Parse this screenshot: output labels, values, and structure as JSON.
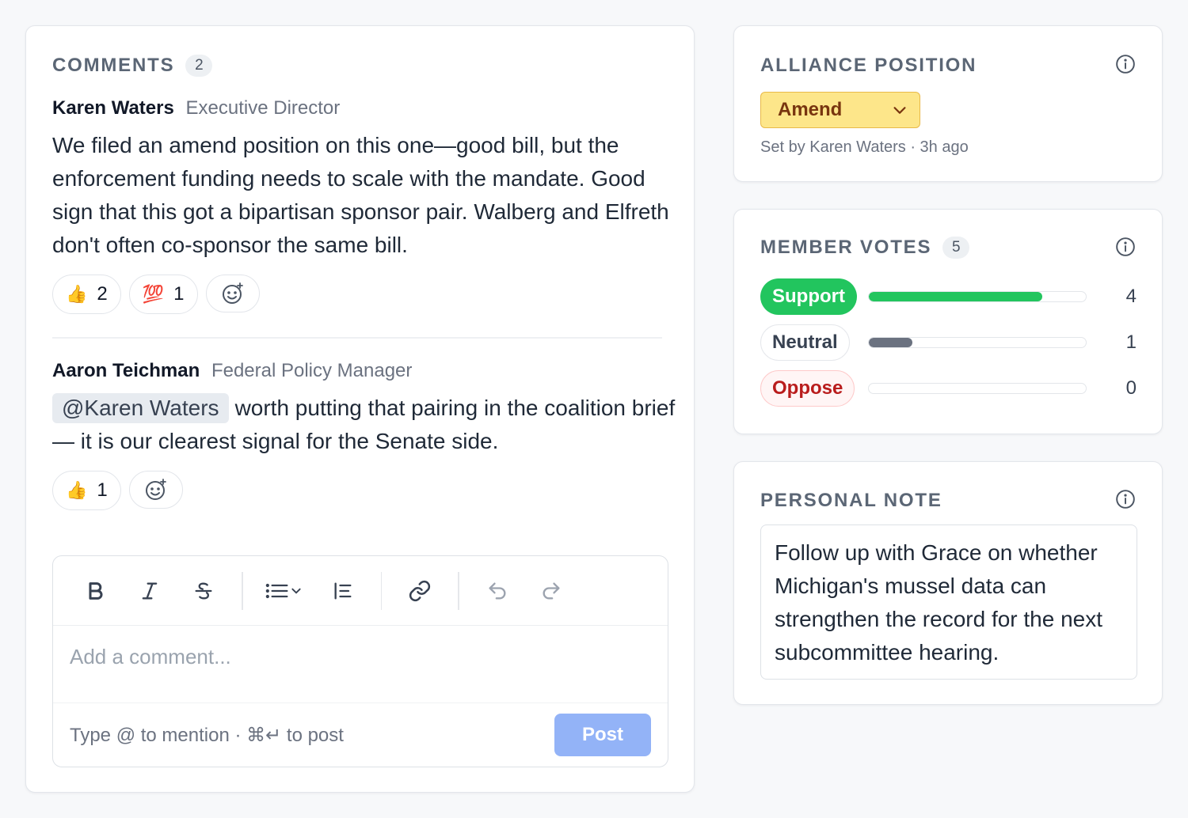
{
  "comments": {
    "title": "COMMENTS",
    "count": "2",
    "items": [
      {
        "author": "Karen Waters",
        "role": "Executive Director",
        "body": "We filed an amend position on this one—good bill, but the enforcement funding needs to scale with the mandate. Good sign that this got a bipartisan sponsor pair. Walberg and Elfreth don't often co-sponsor the same bill.",
        "reactions": [
          {
            "emoji": "👍",
            "icon": "thumbs-up-icon",
            "count": "2"
          },
          {
            "emoji": "💯",
            "icon": "hundred-points-icon",
            "count": "1"
          }
        ]
      },
      {
        "author": "Aaron Teichman",
        "role": "Federal Policy Manager",
        "mention": "@Karen Waters",
        "body": "worth putting that pairing in the coalition brief — it is our clearest signal for the Senate side.",
        "reactions": [
          {
            "emoji": "👍",
            "icon": "thumbs-up-icon",
            "count": "1"
          }
        ]
      }
    ],
    "editor": {
      "placeholder": "Add a comment...",
      "hint": "Type @ to mention · ⌘↵ to post",
      "post_label": "Post",
      "toolbar": [
        "bold-icon",
        "italic-icon",
        "strikethrough-icon",
        "bullet-list-icon",
        "ordered-list-icon",
        "link-icon",
        "undo-icon",
        "redo-icon"
      ]
    }
  },
  "alliance": {
    "title": "ALLIANCE POSITION",
    "selected": "Amend",
    "set_by": "Set by Karen Waters · 3h ago",
    "colors": {
      "bg": "#fde68a",
      "border": "#e9b949",
      "text": "#78350f"
    }
  },
  "votes": {
    "title": "MEMBER VOTES",
    "count": "5",
    "rows": [
      {
        "label": "Support",
        "count": "4",
        "fraction": 0.8,
        "color": "#22c55e"
      },
      {
        "label": "Neutral",
        "count": "1",
        "fraction": 0.2,
        "color": "#6b7280"
      },
      {
        "label": "Oppose",
        "count": "0",
        "fraction": 0,
        "color": "#dc2626"
      }
    ]
  },
  "note": {
    "title": "PERSONAL NOTE",
    "body": "Follow up with Grace on whether Michigan's mussel data can strengthen the record for the next subcommittee hearing."
  }
}
